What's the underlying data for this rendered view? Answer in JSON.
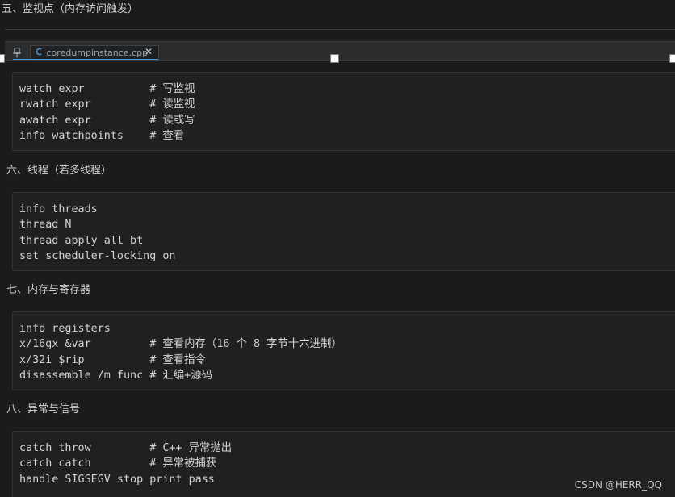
{
  "sections": [
    {
      "heading": "五、监视点（内存访问触发）",
      "lines": [
        "watch expr          # 写监视",
        "rwatch expr         # 读监视",
        "awatch expr         # 读或写",
        "info watchpoints    # 查看"
      ]
    },
    {
      "heading": "六、线程（若多线程）",
      "lines": [
        "info threads",
        "thread N",
        "thread apply all bt",
        "set scheduler-locking on"
      ]
    },
    {
      "heading": "七、内存与寄存器",
      "lines": [
        "info registers",
        "x/16gx &var         # 查看内存（16 个 8 字节十六进制）",
        "x/32i $rip          # 查看指令",
        "disassemble /m func # 汇编+源码"
      ]
    },
    {
      "heading": "八、异常与信号",
      "lines": [
        "catch throw         # C++ 异常抛出",
        "catch catch         # 异常被捕获",
        "handle SIGSEGV stop print pass"
      ]
    }
  ],
  "editor_tab": {
    "filename": "coredumpinstance.cpp",
    "close_glyph": "✕",
    "pin_icon": "pin-icon",
    "file_icon": "cpp-file-icon"
  },
  "watermark": "CSDN @HERR_QQ"
}
